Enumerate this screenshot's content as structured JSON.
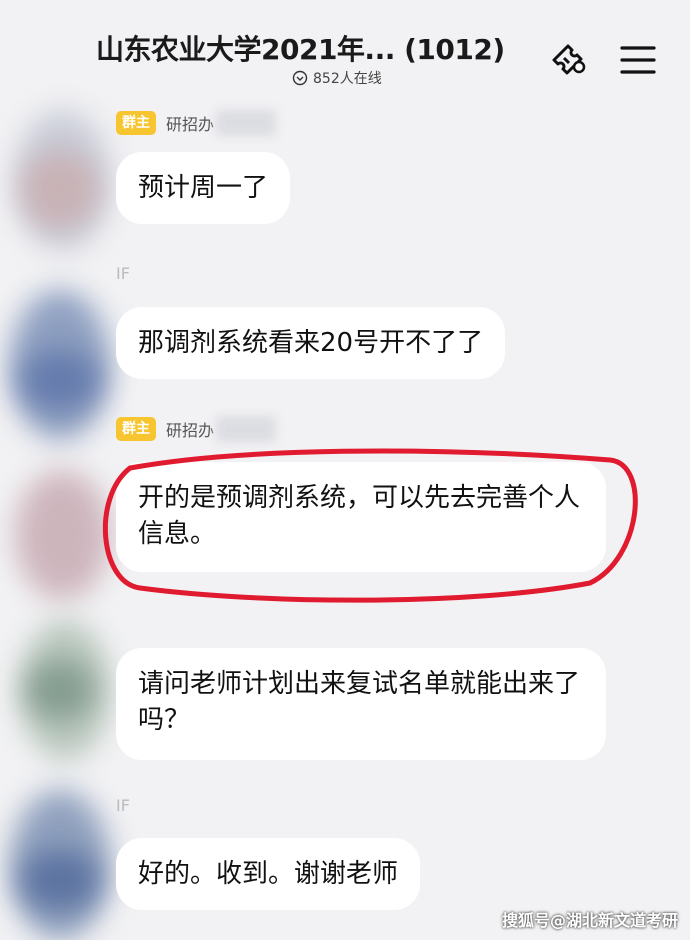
{
  "header": {
    "title": "山东农业大学2021年...  (1012)",
    "online_count": "852人在线"
  },
  "messages": [
    {
      "role": "群主",
      "sender": "研招办",
      "text": "预计周一了"
    },
    {
      "text": "那调剂系统看来20号开不了了"
    },
    {
      "role": "群主",
      "sender": "研招办",
      "text": "开的是预调剂系统，可以先去完善个人信息。"
    },
    {
      "text": "请问老师计划出来复试名单就能出来了吗？"
    },
    {
      "text": "好的。收到。谢谢老师"
    }
  ],
  "marks": {
    "if_1": "IF",
    "if_2": "IF"
  },
  "watermark": "搜狐号@湖北新文道考研",
  "colors": {
    "background": "#f2f2f4",
    "badge": "#f7c530",
    "highlight_stroke": "#e01b2f"
  },
  "icons": {
    "online": "chevron-circle-icon",
    "ticket": "ticket-icon",
    "menu": "menu-icon"
  }
}
